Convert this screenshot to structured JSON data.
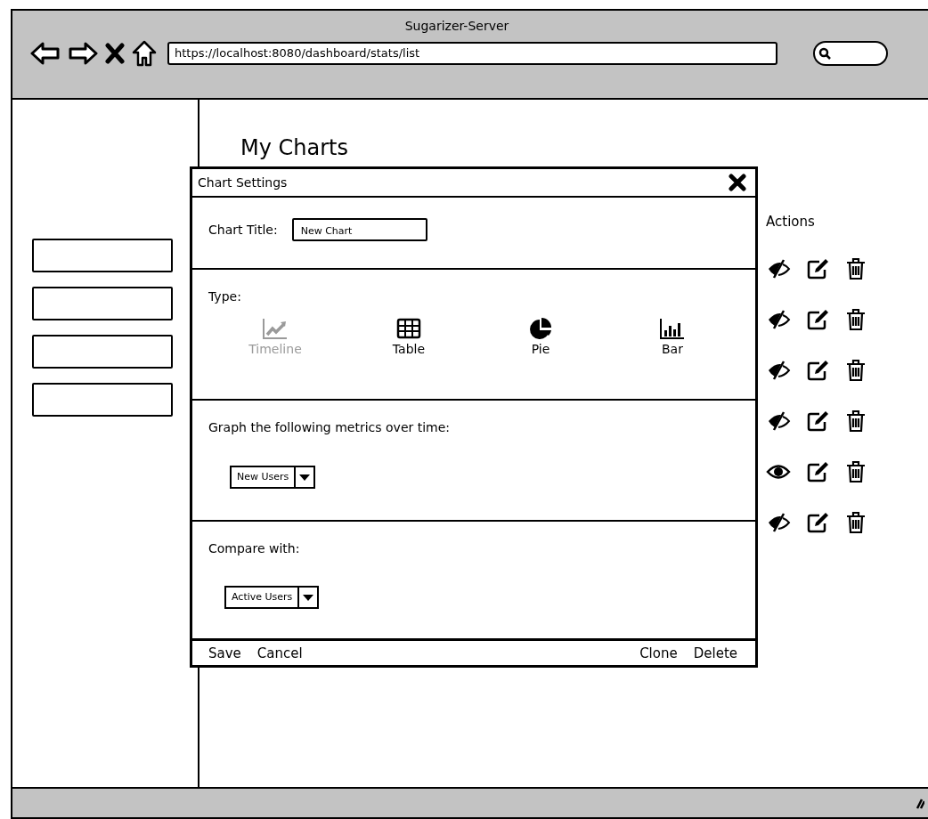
{
  "window": {
    "title": "Sugarizer-Server",
    "url": "https://localhost:8080/dashboard/stats/list"
  },
  "sidebar": {
    "items": [
      {
        "kind": "button"
      },
      {
        "kind": "button"
      },
      {
        "kind": "button"
      },
      {
        "kind": "button"
      }
    ]
  },
  "page": {
    "heading": "My Charts",
    "actions_heading": "Actions",
    "rows": [
      {
        "visible": false
      },
      {
        "visible": false
      },
      {
        "visible": false
      },
      {
        "visible": false
      },
      {
        "visible": true
      },
      {
        "visible": false
      }
    ]
  },
  "dialog": {
    "title": "Chart Settings",
    "chart_title_label": "Chart Title:",
    "chart_title_value": "New Chart",
    "type_label": "Type:",
    "types": [
      {
        "label": "Timeline",
        "kind": "timeline",
        "disabled": true
      },
      {
        "label": "Table",
        "kind": "table",
        "disabled": false
      },
      {
        "label": "Pie",
        "kind": "pie",
        "disabled": false
      },
      {
        "label": "Bar",
        "kind": "bar",
        "disabled": false
      }
    ],
    "metrics_label": "Graph the following metrics over time:",
    "metric": "New Users",
    "compare_label": "Compare with:",
    "compare": "Active Users",
    "footer_left": [
      "Save",
      "Cancel"
    ],
    "footer_right": [
      "Clone",
      "Delete"
    ]
  }
}
